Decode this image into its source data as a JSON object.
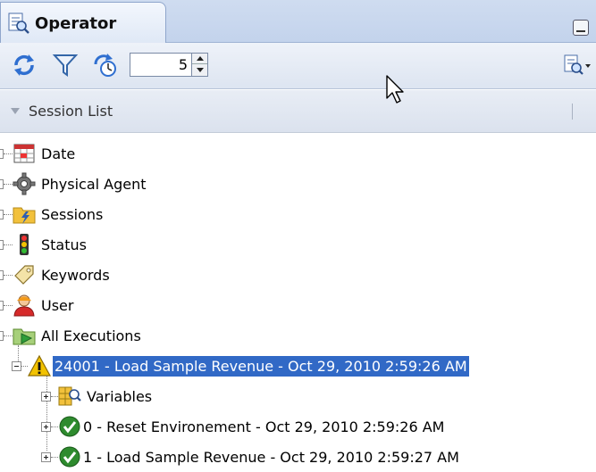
{
  "tab": {
    "label": "Operator"
  },
  "toolbar": {
    "session_count": "5"
  },
  "section": {
    "label": "Session List"
  },
  "tree": {
    "root_items": [
      {
        "label": "Date",
        "icon": "calendar-icon"
      },
      {
        "label": "Physical Agent",
        "icon": "gear-icon"
      },
      {
        "label": "Sessions",
        "icon": "folder-lightning-icon"
      },
      {
        "label": "Status",
        "icon": "traffic-light-icon"
      },
      {
        "label": "Keywords",
        "icon": "tag-icon"
      },
      {
        "label": "User",
        "icon": "user-icon"
      },
      {
        "label": "All Executions",
        "icon": "folder-play-icon"
      }
    ],
    "session": {
      "label": "24001 - Load Sample Revenue - Oct 29, 2010 2:59:26 AM",
      "icon": "warning-icon",
      "selected": true
    },
    "children": [
      {
        "label": "Variables",
        "icon": "variables-icon"
      },
      {
        "label": "0 - Reset Environement - Oct 29, 2010 2:59:26 AM",
        "icon": "success-check-icon"
      },
      {
        "label": "1 - Load Sample Revenue - Oct 29, 2010 2:59:27 AM",
        "icon": "success-check-icon"
      }
    ]
  },
  "colors": {
    "selection": "#3169c6",
    "tab_bar": "#c9d7ee",
    "warning": "#f2c200",
    "success": "#2e8b2e"
  }
}
